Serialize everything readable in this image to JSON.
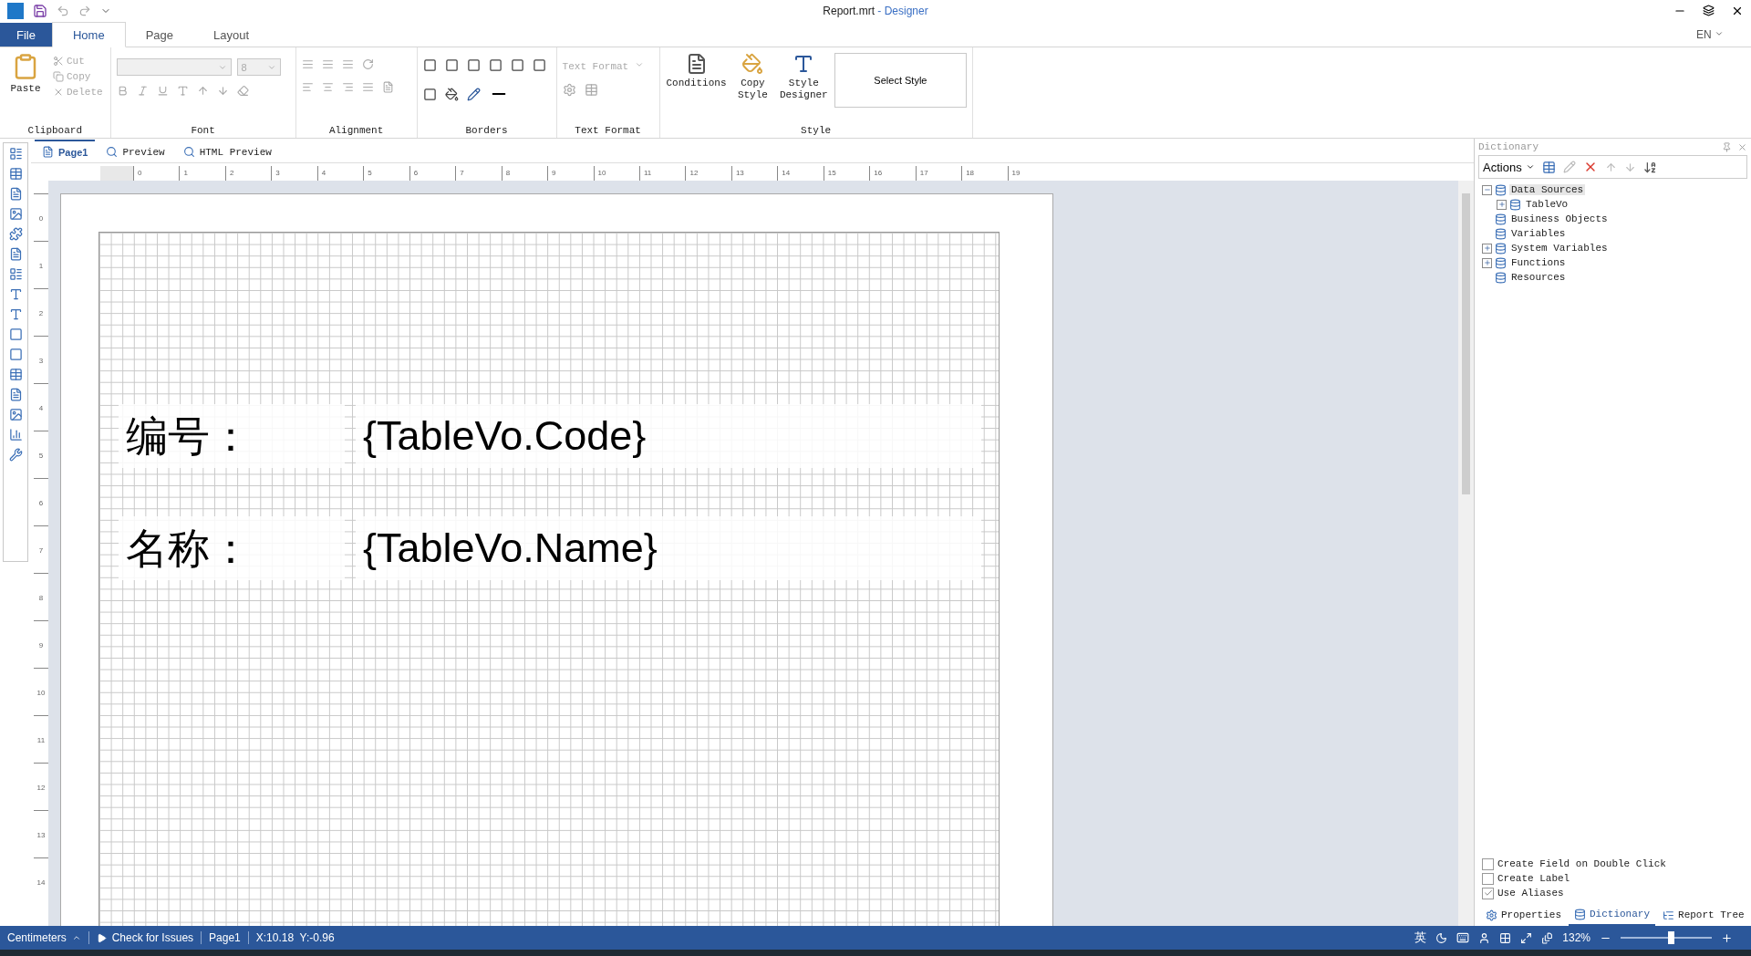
{
  "title_bar": {
    "file": "Report.mrt",
    "app": "- Designer"
  },
  "ribbon_tabs": [
    {
      "label": "File",
      "kind": "file",
      "selected": false
    },
    {
      "label": "Home",
      "kind": "tab",
      "selected": true
    },
    {
      "label": "Page",
      "kind": "tab",
      "selected": false
    },
    {
      "label": "Layout",
      "kind": "tab",
      "selected": false
    }
  ],
  "language": "EN",
  "clipboard": {
    "title": "Clipboard",
    "paste": "Paste",
    "actions": [
      {
        "label": "Cut",
        "disabled": true
      },
      {
        "label": "Copy",
        "disabled": true
      },
      {
        "label": "Delete",
        "disabled": true
      }
    ]
  },
  "font": {
    "title": "Font",
    "size": "8"
  },
  "alignment": {
    "title": "Alignment"
  },
  "borders": {
    "title": "Borders"
  },
  "text_format": {
    "title": "Text Format",
    "dropdown": "Text Format"
  },
  "style": {
    "title": "Style",
    "buttons": [
      "Conditions",
      "Copy Style",
      "Style Designer"
    ],
    "select": "Select Style"
  },
  "doc_tabs": [
    {
      "label": "Page1",
      "selected": true
    },
    {
      "label": "Preview",
      "selected": false
    },
    {
      "label": "HTML Preview",
      "selected": false
    }
  ],
  "ruler_h": [
    "0",
    "1",
    "2",
    "3",
    "4",
    "5",
    "6",
    "7",
    "8",
    "9",
    "10",
    "11",
    "12",
    "13",
    "14",
    "15",
    "16",
    "17",
    "18",
    "19"
  ],
  "ruler_v": [
    "0",
    "1",
    "2",
    "3",
    "4",
    "5",
    "6",
    "7",
    "8",
    "9",
    "10",
    "11",
    "12",
    "13",
    "14"
  ],
  "report_rows": [
    {
      "label": "编号：",
      "value": "{TableVo.Code}"
    },
    {
      "label": "名称：",
      "value": "{TableVo.Name}"
    }
  ],
  "dictionary": {
    "title": "Dictionary",
    "actions": "Actions",
    "tree": [
      {
        "label": "Data Sources",
        "expanded": true,
        "selected": true,
        "children": [
          {
            "label": "TableVo",
            "expanded": false,
            "selected": false
          }
        ]
      },
      {
        "label": "Business Objects",
        "selected": false
      },
      {
        "label": "Variables",
        "selected": false
      },
      {
        "label": "System Variables",
        "expanded": false,
        "selected": false
      },
      {
        "label": "Functions",
        "expanded": false,
        "selected": false
      },
      {
        "label": "Resources",
        "selected": false
      }
    ],
    "options": [
      {
        "label": "Create Field on Double Click",
        "checked": false
      },
      {
        "label": "Create Label",
        "checked": false
      },
      {
        "label": "Use Aliases",
        "checked": true
      }
    ],
    "tabs": [
      {
        "label": "Properties",
        "selected": false
      },
      {
        "label": "Dictionary",
        "selected": true
      },
      {
        "label": "Report Tree",
        "selected": false
      }
    ]
  },
  "status_bar": {
    "units": "Centimeters",
    "check": "Check for Issues",
    "page": "Page1",
    "position": "X:10.18  Y:-0.96",
    "ime": "英",
    "zoom": "132%",
    "level": 0.55
  }
}
